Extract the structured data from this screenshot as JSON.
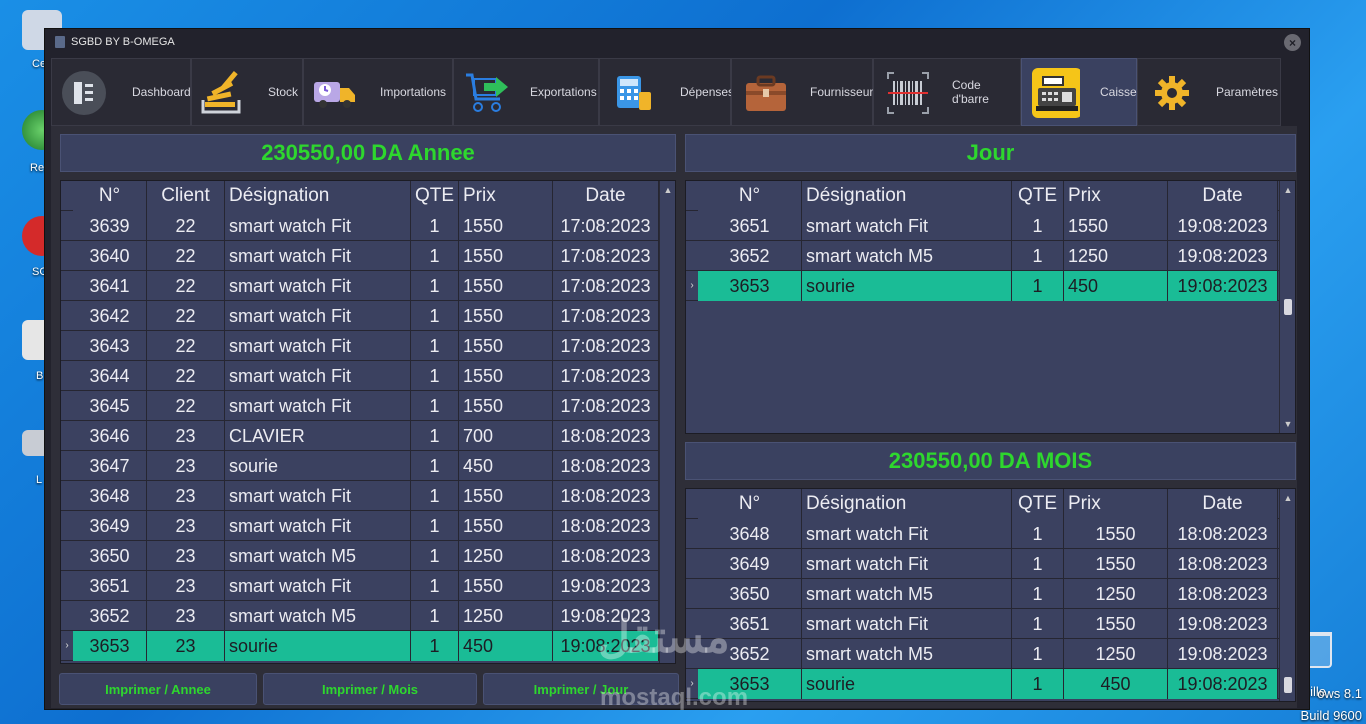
{
  "window": {
    "title": "SGBD BY B-OMEGA"
  },
  "desktop": {
    "icons": [
      {
        "label": "Ce",
        "icon": "computer-icon"
      },
      {
        "label": "Re",
        "icon": "network-icon"
      },
      {
        "label": "SG",
        "icon": "app-icon"
      },
      {
        "label": "B",
        "icon": "document-icon"
      },
      {
        "label": "L",
        "icon": "drive-icon"
      }
    ],
    "corner": {
      "line1": "eille",
      "line2": "ows 8.1",
      "line3": "Build 9600"
    }
  },
  "tabs": [
    {
      "label": "Dashboard",
      "icon": "dashboard-icon"
    },
    {
      "label": "Stock",
      "icon": "stock-icon"
    },
    {
      "label": "Importations",
      "icon": "truck-icon"
    },
    {
      "label": "Exportations",
      "icon": "cart-export-icon"
    },
    {
      "label": "Dépenses",
      "icon": "calculator-icon"
    },
    {
      "label": "Fournisseur",
      "icon": "briefcase-icon"
    },
    {
      "label": "Code d'barre",
      "icon": "barcode-icon"
    },
    {
      "label": "Caisse",
      "icon": "cash-register-icon",
      "active": true
    },
    {
      "label": "Paramètres",
      "icon": "gear-icon"
    }
  ],
  "year_panel": {
    "header": "230550,00 DA Annee",
    "columns": [
      "N°",
      "Client",
      "Désignation",
      "QTE",
      "Prix",
      "Date"
    ],
    "rows": [
      [
        "3639",
        "22",
        "smart watch Fit",
        "1",
        "1550",
        "17:08:2023"
      ],
      [
        "3640",
        "22",
        "smart watch Fit",
        "1",
        "1550",
        "17:08:2023"
      ],
      [
        "3641",
        "22",
        "smart watch Fit",
        "1",
        "1550",
        "17:08:2023"
      ],
      [
        "3642",
        "22",
        "smart watch Fit",
        "1",
        "1550",
        "17:08:2023"
      ],
      [
        "3643",
        "22",
        "smart watch Fit",
        "1",
        "1550",
        "17:08:2023"
      ],
      [
        "3644",
        "22",
        "smart watch Fit",
        "1",
        "1550",
        "17:08:2023"
      ],
      [
        "3645",
        "22",
        "smart watch Fit",
        "1",
        "1550",
        "17:08:2023"
      ],
      [
        "3646",
        "23",
        "CLAVIER",
        "1",
        "700",
        "18:08:2023"
      ],
      [
        "3647",
        "23",
        "sourie",
        "1",
        "450",
        "18:08:2023"
      ],
      [
        "3648",
        "23",
        "smart watch Fit",
        "1",
        "1550",
        "18:08:2023"
      ],
      [
        "3649",
        "23",
        "smart watch Fit",
        "1",
        "1550",
        "18:08:2023"
      ],
      [
        "3650",
        "23",
        "smart watch M5",
        "1",
        "1250",
        "18:08:2023"
      ],
      [
        "3651",
        "23",
        "smart watch Fit",
        "1",
        "1550",
        "19:08:2023"
      ],
      [
        "3652",
        "23",
        "smart watch M5",
        "1",
        "1250",
        "19:08:2023"
      ],
      [
        "3653",
        "23",
        "sourie",
        "1",
        "450",
        "19:08:2023"
      ]
    ]
  },
  "day_panel": {
    "header": "Jour",
    "columns": [
      "N°",
      "Désignation",
      "QTE",
      "Prix",
      "Date"
    ],
    "rows": [
      [
        "3651",
        "smart watch Fit",
        "1",
        "1550",
        "19:08:2023"
      ],
      [
        "3652",
        "smart watch M5",
        "1",
        "1250",
        "19:08:2023"
      ],
      [
        "3653",
        "sourie",
        "1",
        "450",
        "19:08:2023"
      ]
    ]
  },
  "month_panel": {
    "header": "230550,00 DA MOIS",
    "columns": [
      "N°",
      "Désignation",
      "QTE",
      "Prix",
      "Date"
    ],
    "rows": [
      [
        "3648",
        "smart watch Fit",
        "1",
        "1550",
        "18:08:2023"
      ],
      [
        "3649",
        "smart watch Fit",
        "1",
        "1550",
        "18:08:2023"
      ],
      [
        "3650",
        "smart watch M5",
        "1",
        "1250",
        "18:08:2023"
      ],
      [
        "3651",
        "smart watch Fit",
        "1",
        "1550",
        "19:08:2023"
      ],
      [
        "3652",
        "smart watch M5",
        "1",
        "1250",
        "19:08:2023"
      ],
      [
        "3653",
        "sourie",
        "1",
        "450",
        "19:08:2023"
      ]
    ]
  },
  "buttons": {
    "print_year": "Imprimer / Annee",
    "print_month": "Imprimer / Mois",
    "print_day": "Imprimer / Jour"
  },
  "watermark": {
    "arabic": "مستقل",
    "latin": "mostaql.com"
  },
  "colors": {
    "accent_green": "#2ed72e",
    "selection": "#1abc96",
    "panel": "#3b4160",
    "window": "#22222c"
  }
}
